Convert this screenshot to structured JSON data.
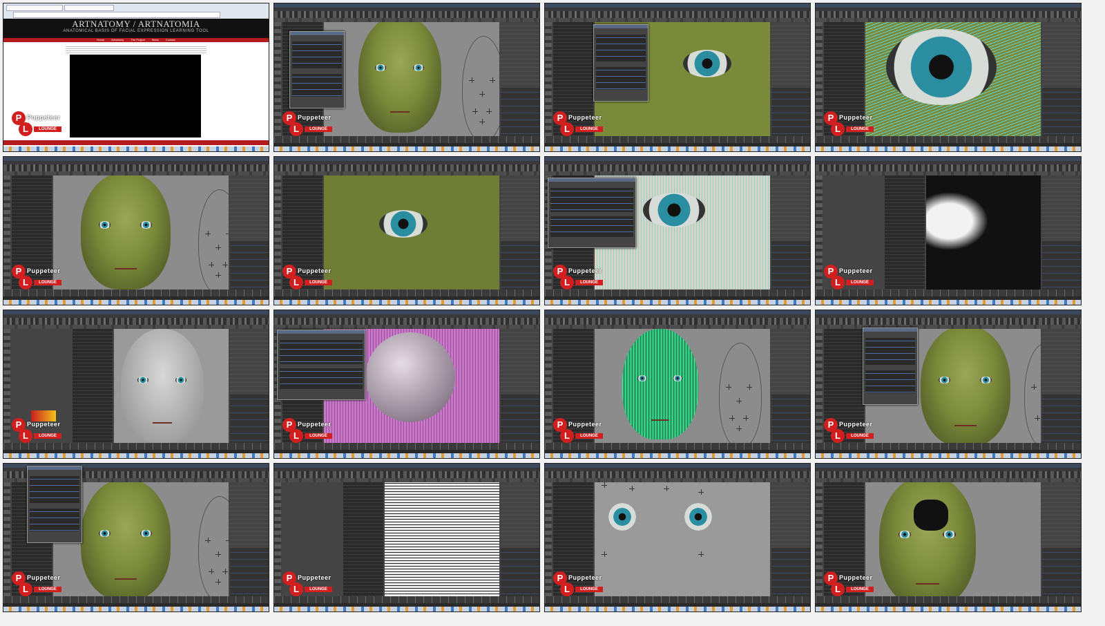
{
  "browser": {
    "site_title": "ARTNATOMY / ARTNATOMIA",
    "site_subtitle": "ANATOMICAL BASIS OF FACIAL EXPRESSION LEARNING TOOL",
    "nav": [
      "Home",
      "Artnatomy",
      "The Project",
      "News",
      "Contact"
    ]
  },
  "watermark": {
    "brand_text": "Puppeteer",
    "letter_p": "P",
    "letter_l": "L",
    "sub_text": "LOUNGE"
  },
  "colors": {
    "maya_panel": "#444444",
    "viewport_gray": "#8c8c8c",
    "creature_skin": "#7b8a3a",
    "iris": "#2a8ea0",
    "selection_green": "#3dff9a",
    "selection_magenta": "#d84bd8",
    "watermark_red": "#d11f1f"
  },
  "tiles": [
    {
      "id": "browser-artnatomy"
    },
    {
      "id": "maya-face-front-dialog"
    },
    {
      "id": "maya-eye-closeup-dialog"
    },
    {
      "id": "maya-eye-wireframe"
    },
    {
      "id": "maya-face-three-quarter"
    },
    {
      "id": "maya-eye-closeup"
    },
    {
      "id": "maya-eyelid-wire-dialog"
    },
    {
      "id": "maya-eye-tunnel-wire"
    },
    {
      "id": "maya-paint-weights"
    },
    {
      "id": "maya-eyeball-magenta"
    },
    {
      "id": "maya-head-wire-green"
    },
    {
      "id": "maya-face-dialog-right"
    },
    {
      "id": "maya-face-wink-dialog"
    },
    {
      "id": "maya-eyeball-wire"
    },
    {
      "id": "maya-eyeballs-only"
    },
    {
      "id": "maya-face-dark-socket"
    }
  ]
}
